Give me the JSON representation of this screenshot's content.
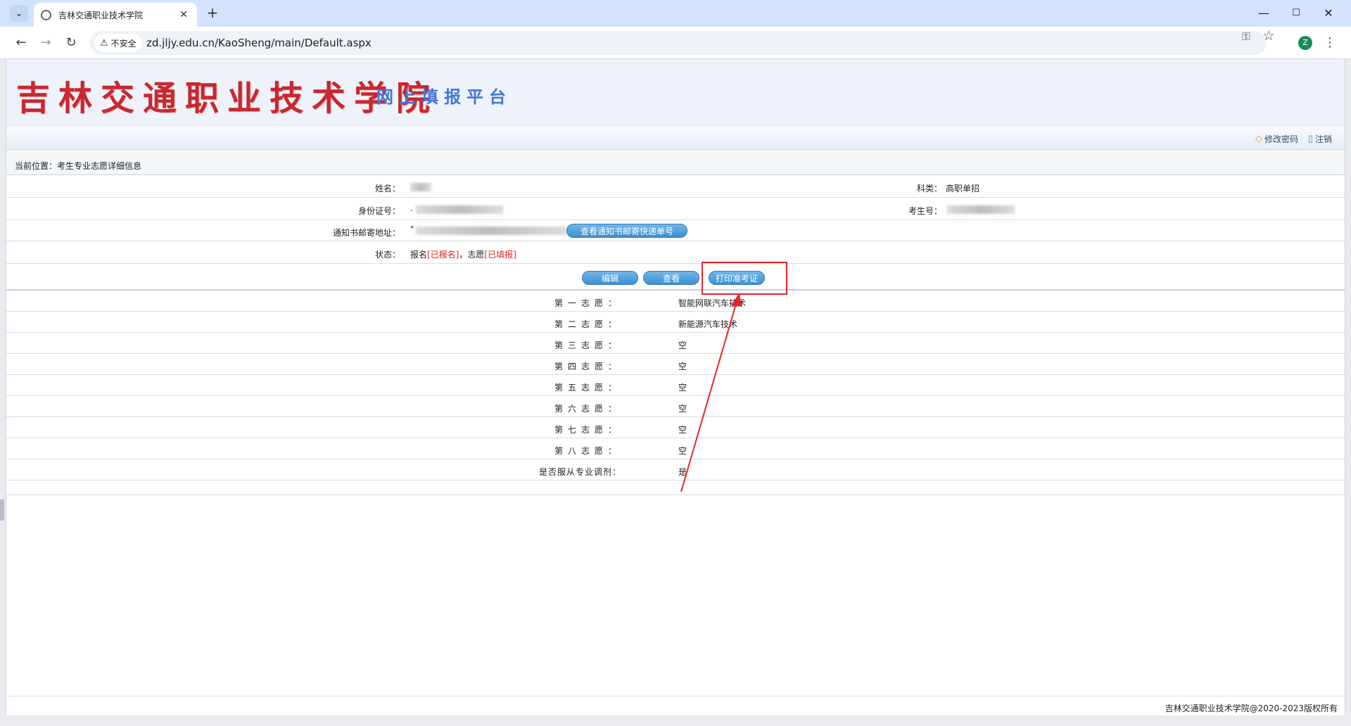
{
  "browser": {
    "tab_title": "吉林交通职业技术学院",
    "security_label": "不安全",
    "url": "zd.jljy.edu.cn/KaoSheng/main/Default.aspx",
    "profile_initial": "Z",
    "icons": [
      "tab-list-icon",
      "globe-favicon-icon",
      "close-tab-icon",
      "new-tab-icon",
      "minimize-icon",
      "maximize-icon",
      "close-window-icon",
      "back-icon",
      "forward-icon",
      "reload-icon",
      "warning-icon",
      "key-icon",
      "star-icon",
      "menu-icon"
    ]
  },
  "banner": {
    "title": "吉林交通职业技术学院",
    "subtitle": "网上填报平台"
  },
  "userbar": {
    "change_password": "修改密码",
    "logout": "注销"
  },
  "breadcrumb": "当前位置：考生专业志愿详细信息",
  "info": {
    "name_label": "姓名：",
    "category_label": "科类：",
    "category_value": "高职单招",
    "id_label": "身份证号：",
    "id_value": ".",
    "exam_no_label": "考生号：",
    "address_label": "通知书邮寄地址：",
    "address_value": "\"",
    "express_button": "查看通知书邮寄快递单号",
    "status_label": "状态：",
    "status_prefix": "报名",
    "status_enroll": "[已报名]",
    "status_mid": "，志愿",
    "status_choice": "[已填报]"
  },
  "actions": {
    "edit": "编辑",
    "view": "查看",
    "print": "打印准考证"
  },
  "choices": [
    {
      "label": "第一志愿：",
      "value": "智能网联汽车技术"
    },
    {
      "label": "第二志愿：",
      "value": "新能源汽车技术"
    },
    {
      "label": "第三志愿：",
      "value": "空"
    },
    {
      "label": "第四志愿：",
      "value": "空"
    },
    {
      "label": "第五志愿：",
      "value": "空"
    },
    {
      "label": "第六志愿：",
      "value": "空"
    },
    {
      "label": "第七志愿：",
      "value": "空"
    },
    {
      "label": "第八志愿：",
      "value": "空"
    },
    {
      "label": "是否服从专业调剂：",
      "value": "是"
    }
  ],
  "footer": {
    "copyright": "吉林交通职业技术学院@2020-2023版权所有"
  },
  "colors": {
    "banner_title": "#c8282f",
    "banner_subtitle": "#3e78d6",
    "button_blue": "#4a9ad8",
    "annotation_red": "#e3262a",
    "status_red": "#e02020"
  }
}
